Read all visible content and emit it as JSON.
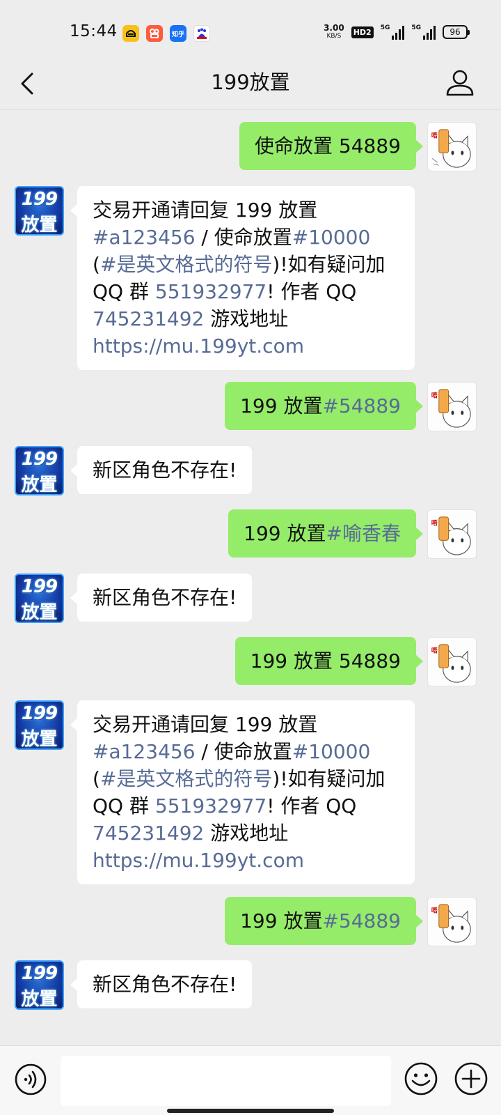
{
  "status_bar": {
    "time": "15:44",
    "net_speed": "3.00",
    "net_unit": "KB/S",
    "hd_badge": "HD2",
    "signal_1": "5G",
    "signal_2": "5G",
    "battery": "96",
    "app_icons": [
      "car-app-icon",
      "kuaishou-icon",
      "zhihu-icon",
      "baidu-icon"
    ],
    "zhihu_label": "知乎"
  },
  "nav": {
    "title": "199放置"
  },
  "bot_avatar": {
    "line1": "199",
    "line2": "放置"
  },
  "messages": [
    {
      "side": "right",
      "parts": [
        {
          "t": "使命放置 54889",
          "link": false
        }
      ]
    },
    {
      "side": "left",
      "parts": [
        {
          "t": "交易开通请回复 199 放置",
          "link": false
        },
        {
          "t": "#a123456",
          "link": true
        },
        {
          "t": " / 使命放置",
          "link": false
        },
        {
          "t": "#10000",
          "link": true
        },
        {
          "t": " (",
          "link": false
        },
        {
          "t": "#是英文格式的符号",
          "link": true
        },
        {
          "t": ")!如有疑问加 QQ 群 ",
          "link": false
        },
        {
          "t": "551932977",
          "link": true
        },
        {
          "t": "! 作者 QQ ",
          "link": false
        },
        {
          "t": "745231492",
          "link": true
        },
        {
          "t": " 游戏地址 ",
          "link": false
        },
        {
          "t": "https://mu.199yt.com",
          "link": true
        }
      ]
    },
    {
      "side": "right",
      "parts": [
        {
          "t": "199 放置",
          "link": false
        },
        {
          "t": "#54889",
          "link": true
        }
      ]
    },
    {
      "side": "left",
      "parts": [
        {
          "t": "新区角色不存在!",
          "link": false
        }
      ]
    },
    {
      "side": "right",
      "parts": [
        {
          "t": "199 放置",
          "link": false
        },
        {
          "t": "#喻香春",
          "link": true
        }
      ]
    },
    {
      "side": "left",
      "parts": [
        {
          "t": "新区角色不存在!",
          "link": false
        }
      ]
    },
    {
      "side": "right",
      "parts": [
        {
          "t": "199 放置 54889",
          "link": false
        }
      ]
    },
    {
      "side": "left",
      "parts": [
        {
          "t": "交易开通请回复 199 放置",
          "link": false
        },
        {
          "t": "#a123456",
          "link": true
        },
        {
          "t": " / 使命放置",
          "link": false
        },
        {
          "t": "#10000",
          "link": true
        },
        {
          "t": " (",
          "link": false
        },
        {
          "t": "#是英文格式的符号",
          "link": true
        },
        {
          "t": ")!如有疑问加 QQ 群 ",
          "link": false
        },
        {
          "t": "551932977",
          "link": true
        },
        {
          "t": "! 作者 QQ ",
          "link": false
        },
        {
          "t": "745231492",
          "link": true
        },
        {
          "t": " 游戏地址 ",
          "link": false
        },
        {
          "t": "https://mu.199yt.com",
          "link": true
        }
      ]
    },
    {
      "side": "right",
      "parts": [
        {
          "t": "199 放置",
          "link": false
        },
        {
          "t": "#54889",
          "link": true
        }
      ]
    },
    {
      "side": "left",
      "parts": [
        {
          "t": "新区角色不存在!",
          "link": false
        }
      ]
    }
  ],
  "input": {
    "value": ""
  },
  "colors": {
    "background": "#ededed",
    "sent_bubble": "#95ec69",
    "received_bubble": "#ffffff",
    "link": "#576b95"
  },
  "icons": {
    "back": "back-icon",
    "profile": "profile-icon",
    "voice": "voice-icon",
    "emoji": "emoji-icon",
    "more": "plus-icon"
  }
}
